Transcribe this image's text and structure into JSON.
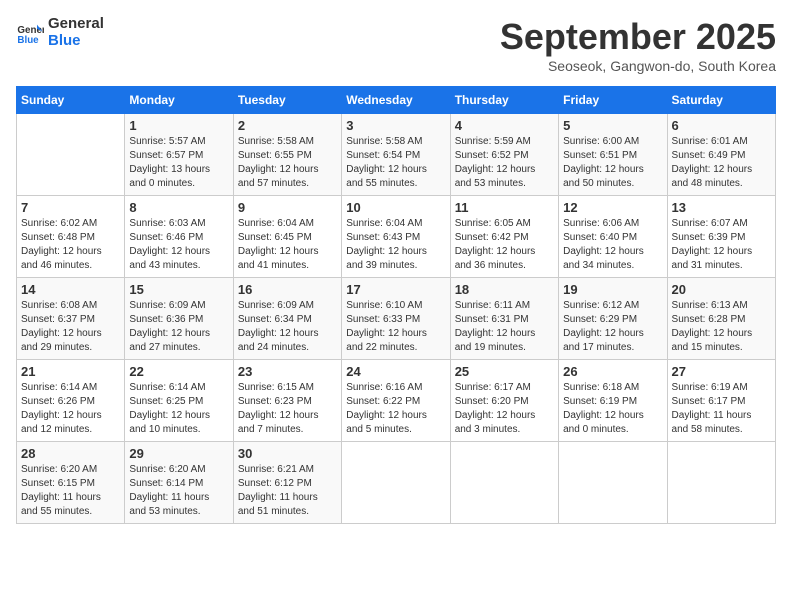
{
  "header": {
    "logo_line1": "General",
    "logo_line2": "Blue",
    "month": "September 2025",
    "location": "Seoseok, Gangwon-do, South Korea"
  },
  "weekdays": [
    "Sunday",
    "Monday",
    "Tuesday",
    "Wednesday",
    "Thursday",
    "Friday",
    "Saturday"
  ],
  "weeks": [
    [
      {
        "day": "",
        "info": ""
      },
      {
        "day": "1",
        "info": "Sunrise: 5:57 AM\nSunset: 6:57 PM\nDaylight: 13 hours\nand 0 minutes."
      },
      {
        "day": "2",
        "info": "Sunrise: 5:58 AM\nSunset: 6:55 PM\nDaylight: 12 hours\nand 57 minutes."
      },
      {
        "day": "3",
        "info": "Sunrise: 5:58 AM\nSunset: 6:54 PM\nDaylight: 12 hours\nand 55 minutes."
      },
      {
        "day": "4",
        "info": "Sunrise: 5:59 AM\nSunset: 6:52 PM\nDaylight: 12 hours\nand 53 minutes."
      },
      {
        "day": "5",
        "info": "Sunrise: 6:00 AM\nSunset: 6:51 PM\nDaylight: 12 hours\nand 50 minutes."
      },
      {
        "day": "6",
        "info": "Sunrise: 6:01 AM\nSunset: 6:49 PM\nDaylight: 12 hours\nand 48 minutes."
      }
    ],
    [
      {
        "day": "7",
        "info": "Sunrise: 6:02 AM\nSunset: 6:48 PM\nDaylight: 12 hours\nand 46 minutes."
      },
      {
        "day": "8",
        "info": "Sunrise: 6:03 AM\nSunset: 6:46 PM\nDaylight: 12 hours\nand 43 minutes."
      },
      {
        "day": "9",
        "info": "Sunrise: 6:04 AM\nSunset: 6:45 PM\nDaylight: 12 hours\nand 41 minutes."
      },
      {
        "day": "10",
        "info": "Sunrise: 6:04 AM\nSunset: 6:43 PM\nDaylight: 12 hours\nand 39 minutes."
      },
      {
        "day": "11",
        "info": "Sunrise: 6:05 AM\nSunset: 6:42 PM\nDaylight: 12 hours\nand 36 minutes."
      },
      {
        "day": "12",
        "info": "Sunrise: 6:06 AM\nSunset: 6:40 PM\nDaylight: 12 hours\nand 34 minutes."
      },
      {
        "day": "13",
        "info": "Sunrise: 6:07 AM\nSunset: 6:39 PM\nDaylight: 12 hours\nand 31 minutes."
      }
    ],
    [
      {
        "day": "14",
        "info": "Sunrise: 6:08 AM\nSunset: 6:37 PM\nDaylight: 12 hours\nand 29 minutes."
      },
      {
        "day": "15",
        "info": "Sunrise: 6:09 AM\nSunset: 6:36 PM\nDaylight: 12 hours\nand 27 minutes."
      },
      {
        "day": "16",
        "info": "Sunrise: 6:09 AM\nSunset: 6:34 PM\nDaylight: 12 hours\nand 24 minutes."
      },
      {
        "day": "17",
        "info": "Sunrise: 6:10 AM\nSunset: 6:33 PM\nDaylight: 12 hours\nand 22 minutes."
      },
      {
        "day": "18",
        "info": "Sunrise: 6:11 AM\nSunset: 6:31 PM\nDaylight: 12 hours\nand 19 minutes."
      },
      {
        "day": "19",
        "info": "Sunrise: 6:12 AM\nSunset: 6:29 PM\nDaylight: 12 hours\nand 17 minutes."
      },
      {
        "day": "20",
        "info": "Sunrise: 6:13 AM\nSunset: 6:28 PM\nDaylight: 12 hours\nand 15 minutes."
      }
    ],
    [
      {
        "day": "21",
        "info": "Sunrise: 6:14 AM\nSunset: 6:26 PM\nDaylight: 12 hours\nand 12 minutes."
      },
      {
        "day": "22",
        "info": "Sunrise: 6:14 AM\nSunset: 6:25 PM\nDaylight: 12 hours\nand 10 minutes."
      },
      {
        "day": "23",
        "info": "Sunrise: 6:15 AM\nSunset: 6:23 PM\nDaylight: 12 hours\nand 7 minutes."
      },
      {
        "day": "24",
        "info": "Sunrise: 6:16 AM\nSunset: 6:22 PM\nDaylight: 12 hours\nand 5 minutes."
      },
      {
        "day": "25",
        "info": "Sunrise: 6:17 AM\nSunset: 6:20 PM\nDaylight: 12 hours\nand 3 minutes."
      },
      {
        "day": "26",
        "info": "Sunrise: 6:18 AM\nSunset: 6:19 PM\nDaylight: 12 hours\nand 0 minutes."
      },
      {
        "day": "27",
        "info": "Sunrise: 6:19 AM\nSunset: 6:17 PM\nDaylight: 11 hours\nand 58 minutes."
      }
    ],
    [
      {
        "day": "28",
        "info": "Sunrise: 6:20 AM\nSunset: 6:15 PM\nDaylight: 11 hours\nand 55 minutes."
      },
      {
        "day": "29",
        "info": "Sunrise: 6:20 AM\nSunset: 6:14 PM\nDaylight: 11 hours\nand 53 minutes."
      },
      {
        "day": "30",
        "info": "Sunrise: 6:21 AM\nSunset: 6:12 PM\nDaylight: 11 hours\nand 51 minutes."
      },
      {
        "day": "",
        "info": ""
      },
      {
        "day": "",
        "info": ""
      },
      {
        "day": "",
        "info": ""
      },
      {
        "day": "",
        "info": ""
      }
    ]
  ]
}
